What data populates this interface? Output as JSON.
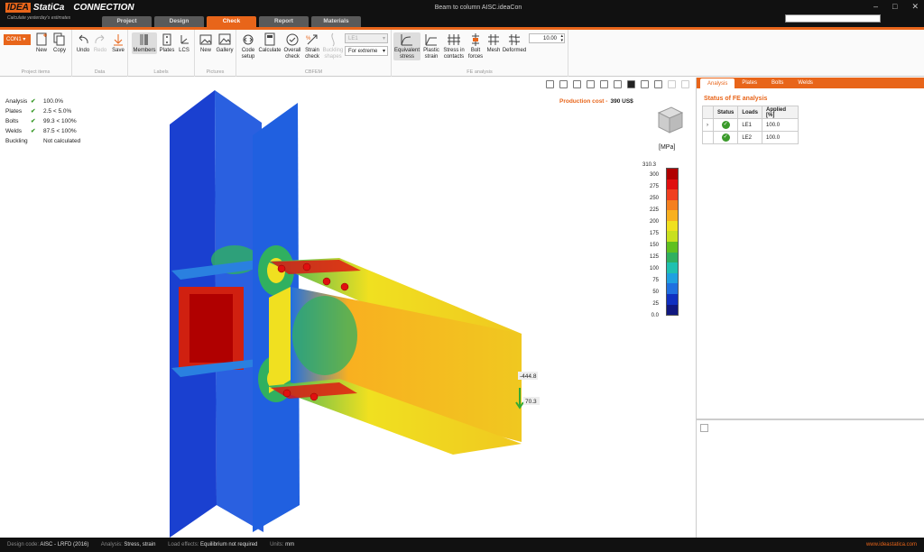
{
  "app": {
    "brand_1": "IDEA",
    "brand_2": "StatiCa",
    "product": "CONNECTION",
    "tagline": "Calculate yesterday's estimates",
    "window_title": "Beam to column AISC.ideaCon",
    "tabs": [
      "Project",
      "Design",
      "Check",
      "Report",
      "Materials"
    ],
    "active_tab": "Check"
  },
  "ribbon": {
    "connection_select": "CON1",
    "project_items": {
      "title": "Project items",
      "new": "New",
      "copy": "Copy"
    },
    "data": {
      "title": "Data",
      "undo": "Undo",
      "redo": "Redo",
      "save": "Save"
    },
    "labels": {
      "title": "Labels",
      "members": "Members",
      "plates": "Plates",
      "lcs": "LCS"
    },
    "pictures": {
      "title": "Pictures",
      "new": "New",
      "gallery": "Gallery"
    },
    "cbfem": {
      "title": "CBFEM",
      "code_setup": "Code setup",
      "calculate": "Calculate",
      "overall_check": "Overall check",
      "strain_check": "Strain check",
      "buckling_shapes": "Buckling shapes",
      "load_select": "LE1",
      "extreme_select": "For extreme"
    },
    "fe_analysis": {
      "title": "FE analysis",
      "equivalent_stress": "Equivalent stress",
      "plastic_strain": "Plastic strain",
      "stress_in_contacts": "Stress in contacts",
      "bolt_forces": "Bolt forces",
      "mesh": "Mesh",
      "deformed": "Deformed",
      "scale_value": "10.00"
    }
  },
  "status": [
    {
      "label": "Analysis",
      "check": true,
      "value": "100.0%"
    },
    {
      "label": "Plates",
      "check": true,
      "value": "2.5 < 5.0%"
    },
    {
      "label": "Bolts",
      "check": true,
      "value": "99.3 < 100%"
    },
    {
      "label": "Welds",
      "check": true,
      "value": "87.5 < 100%"
    },
    {
      "label": "Buckling",
      "check": false,
      "value": "Not calculated"
    }
  ],
  "production_cost": {
    "label": "Production cost",
    "sep": "-",
    "value": "390 US$"
  },
  "legend": {
    "unit": "[MPa]",
    "max": "310.3",
    "ticks": [
      "300",
      "275",
      "250",
      "225",
      "200",
      "175",
      "150",
      "125",
      "100",
      "75",
      "50",
      "25",
      "0.0"
    ],
    "colors": [
      "#b00000",
      "#e01010",
      "#f04020",
      "#f58020",
      "#f8b020",
      "#f0e020",
      "#c8e020",
      "#60c020",
      "#30b060",
      "#20c0b0",
      "#20a0e0",
      "#2070e0",
      "#1030c0",
      "#101880"
    ]
  },
  "model_labels": {
    "force_1": "-444.8",
    "force_2": "70.3"
  },
  "right_panel": {
    "tabs": [
      "Analysis",
      "Plates",
      "Bolts",
      "Welds"
    ],
    "active_tab": "Analysis",
    "section_title": "Status of FE analysis",
    "table": {
      "headers": [
        "Status",
        "Loads",
        "Applied [%]"
      ],
      "rows": [
        {
          "loads": "LE1",
          "applied": "100.0"
        },
        {
          "loads": "LE2",
          "applied": "100.0"
        }
      ]
    }
  },
  "footer": {
    "design_code_label": "Design code:",
    "design_code": "AISC - LRFD (2016)",
    "analysis_label": "Analysis:",
    "analysis": "Stress, strain",
    "load_effects_label": "Load effects:",
    "load_effects": "Equilibrium not required",
    "units_label": "Units:",
    "units": "mm",
    "url": "www.ideastatica.com"
  }
}
